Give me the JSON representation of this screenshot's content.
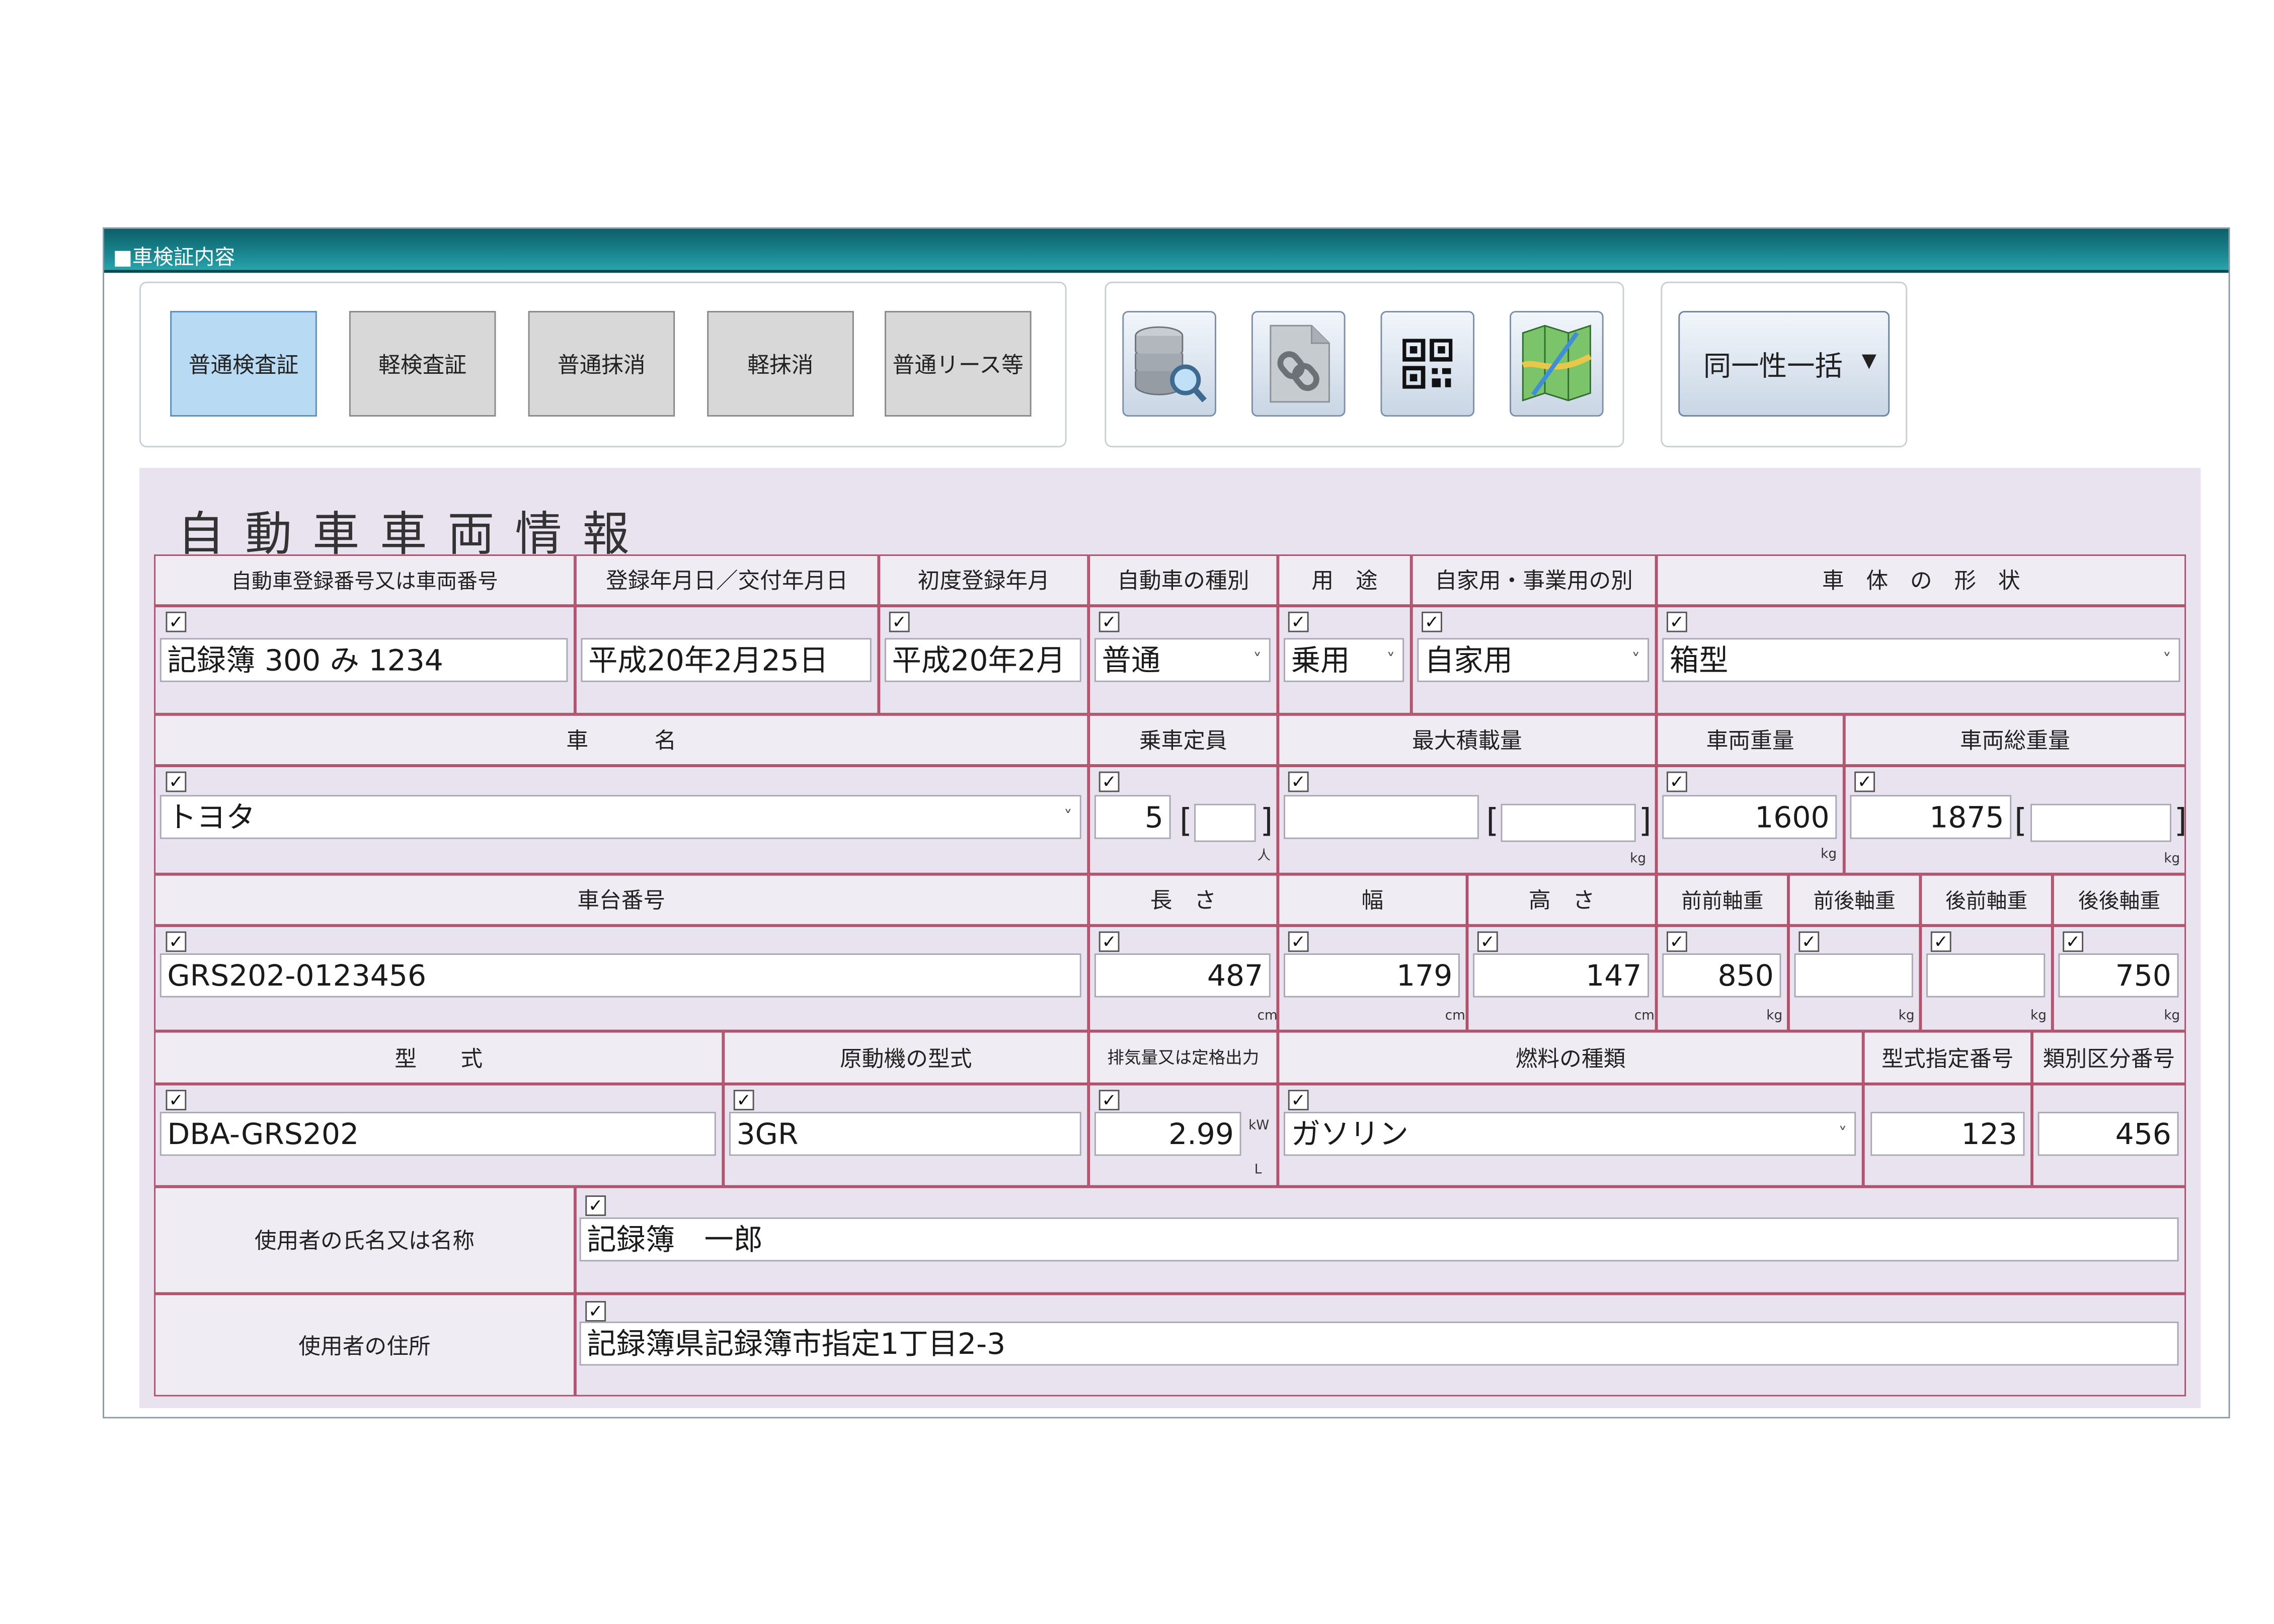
{
  "window": {
    "title": "■車検証内容"
  },
  "record_types": [
    "普通検査証",
    "軽検査証",
    "普通抹消",
    "軽抹消",
    "普通リース等"
  ],
  "tools": [
    {
      "icon": "database-search-icon",
      "name": "database-search"
    },
    {
      "icon": "link-document-icon",
      "name": "link-document"
    },
    {
      "icon": "qr-code-icon",
      "name": "qr-code"
    },
    {
      "icon": "map-icon",
      "name": "map"
    }
  ],
  "bulk_button": {
    "label": "同一性一括",
    "arrow": "▼"
  },
  "form": {
    "heading": "自動車車両情報",
    "check": "✓",
    "headers": {
      "reg_no": "自動車登録番号又は車両番号",
      "reg_date": "登録年月日／交付年月日",
      "first_reg": "初度登録年月",
      "car_kind": "自動車の種別",
      "usage": "用　途",
      "private_business": "自家用・事業用の別",
      "body_shape": "車　体　の　形　状",
      "car_name": "車　　　名",
      "capacity": "乗車定員",
      "max_load": "最大積載量",
      "weight": "車両重量",
      "gross_weight": "車両総重量",
      "chassis_no": "車台番号",
      "length": "長　さ",
      "width": "幅",
      "height": "高　さ",
      "ff_axle": "前前軸重",
      "fr_axle": "前後軸重",
      "rf_axle": "後前軸重",
      "rr_axle": "後後軸重",
      "model": "型　　式",
      "engine_model": "原動機の型式",
      "displacement": "排気量又は定格出力",
      "fuel": "燃料の種類",
      "type_spec_no": "型式指定番号",
      "category_no": "類別区分番号",
      "user_name": "使用者の氏名又は名称",
      "user_address": "使用者の住所"
    },
    "values": {
      "reg_no": "記録簿 300 み 1234",
      "reg_date": "平成20年2月25日",
      "first_reg": "平成20年2月",
      "car_kind": "普通",
      "usage": "乗用",
      "private_business": "自家用",
      "body_shape": "箱型",
      "car_name": "トヨタ",
      "capacity": "5",
      "capacity_sub": "",
      "max_load": "",
      "max_load_sub": "",
      "weight": "1600",
      "gross_weight": "1875",
      "gross_weight_sub": "",
      "chassis_no": "GRS202-0123456",
      "length": "487",
      "width": "179",
      "height": "147",
      "ff_axle": "850",
      "fr_axle": "",
      "rf_axle": "",
      "rr_axle": "750",
      "model": "DBA-GRS202",
      "engine_model": "3GR",
      "displacement": "2.99",
      "fuel": "ガソリン",
      "type_spec_no": "123",
      "category_no": "456",
      "user_name": "記録簿　一郎",
      "user_address": "記録簿県記録簿市指定1丁目2-3"
    },
    "units": {
      "person": "人",
      "kg": "kg",
      "cm": "cm",
      "kw": "kW",
      "liter": "L"
    },
    "dropdown_arrow": "˅"
  }
}
